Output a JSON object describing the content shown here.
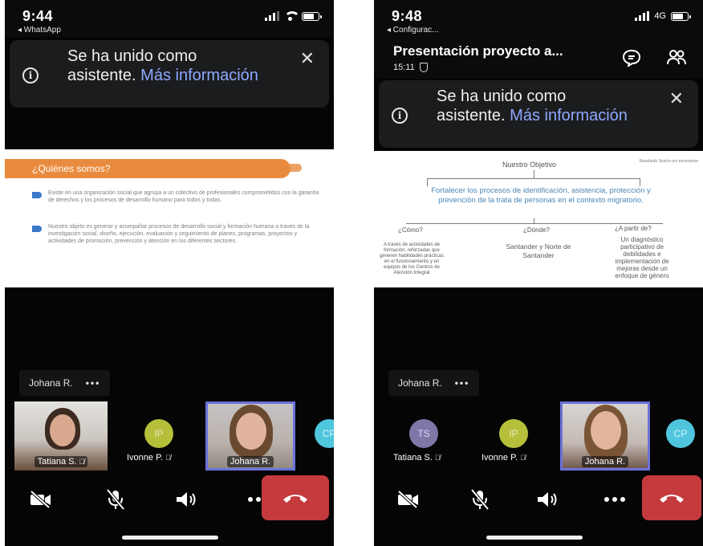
{
  "phones": [
    {
      "status": {
        "time": "9:44",
        "back_label": "◂ WhatsApp"
      },
      "notice": {
        "text": "Se ha unido como asistente.",
        "link": "Más información",
        "close": "✕"
      },
      "slide": {
        "heading": "¿Quiénes somos?",
        "bullet1": "Existe en una organización social que agrupa a un colectivo de profesionales comprometidos con la garantía de derechos y los procesos de desarrollo humano para todos y todas.",
        "bullet2": "Nuestro objeto es generar y acompañar procesos de desarrollo social y formación humana a través de la investigación social, diseño, ejecución, evaluación y seguimiento de planes, programas, proyectos y actividades de promoción, prevención y atención en los diferentes sectores."
      },
      "name_chip": {
        "name": "Johana R.",
        "dots": "•••"
      },
      "participants": [
        {
          "name": "Tatiana S.",
          "type": "video"
        },
        {
          "name": "Ivonne P.",
          "type": "avatar",
          "initials": "IP",
          "color": "#b5bf3a"
        },
        {
          "name": "Johana R.",
          "type": "video",
          "active": true
        },
        {
          "name": "",
          "type": "avatar",
          "initials": "CP",
          "color": "#4fc6de"
        }
      ]
    },
    {
      "status": {
        "time": "9:48",
        "back_label": "◂ Configurac...",
        "network": "4G"
      },
      "header": {
        "title": "Presentación proyecto a...",
        "timer": "15:11"
      },
      "notice": {
        "text": "Se ha unido como asistente.",
        "link": "Más información",
        "close": "✕"
      },
      "slide": {
        "top": "Nuestro Objetivo",
        "side": "Resultado Sesión por escenarios",
        "main": "Fortalecer los procesos de identificación, asistencia, protección y prevención de la trata de personas en el contexto migratorio.",
        "q1": "¿Cómo?",
        "q2": "¿Dónde?",
        "q3": "¿A partir de?",
        "a1": "A través de actividades de formación, reforzadas que generen habilidades prácticas en el funcionamiento y en equipos de los Centros de Atención Integral",
        "a2": "Santander y Norte de Santander",
        "a3": "Un diagnóstico participativo de debilidades e implementación de mejoras desde un enfoque de género"
      },
      "name_chip": {
        "name": "Johana R.",
        "dots": "•••"
      },
      "participants": [
        {
          "name": "Tatiana S.",
          "type": "avatar",
          "initials": "TS",
          "color": "#7d78a8"
        },
        {
          "name": "Ivonne P.",
          "type": "avatar",
          "initials": "IP",
          "color": "#b5bf3a"
        },
        {
          "name": "Johana R.",
          "type": "video",
          "active": true
        },
        {
          "name": "",
          "type": "avatar",
          "initials": "CP",
          "color": "#4fc6de"
        }
      ]
    }
  ],
  "colors": {
    "accent_link": "#8fa8ff",
    "hangup": "#c53a3d",
    "active_border": "#6b72d8",
    "slide_orange": "#e98b3e",
    "slide_blue": "#4b86b5"
  },
  "icons": [
    "info-icon",
    "close-icon",
    "chat-icon",
    "people-icon",
    "camera-off-icon",
    "mic-off-icon",
    "speaker-icon",
    "more-icon",
    "hangup-icon"
  ]
}
